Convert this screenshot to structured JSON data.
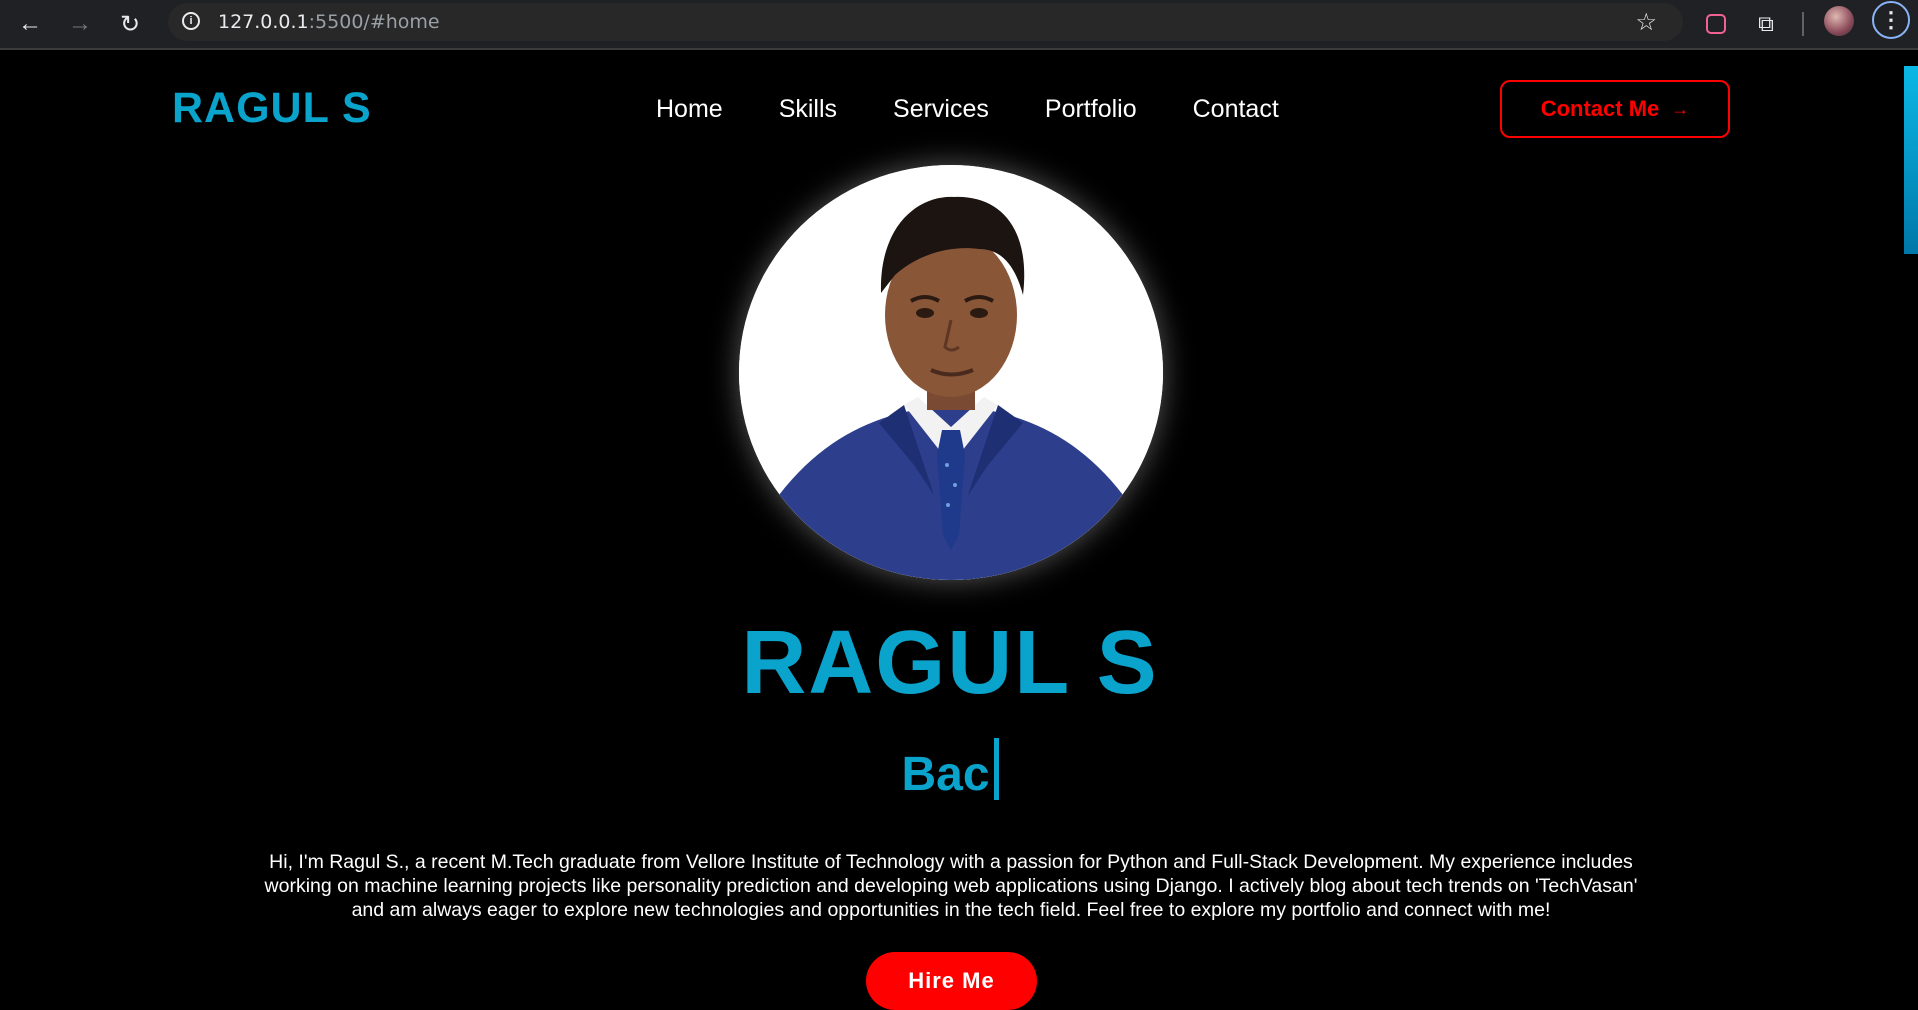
{
  "browser": {
    "url_host": "127.0.0.1",
    "url_rest": ":5500/#home",
    "icons": {
      "back": "arrow-left-icon",
      "forward": "arrow-right-icon",
      "reload": "reload-icon",
      "site_info": "info-icon",
      "bookmark": "star-icon",
      "extension": "lens-icon",
      "extensions": "puzzle-icon",
      "menu": "kebab-menu-icon"
    }
  },
  "header": {
    "logo": "RAGUL S",
    "nav": [
      "Home",
      "Skills",
      "Services",
      "Portfolio",
      "Contact"
    ],
    "contact_button": "Contact Me",
    "contact_arrow": "→"
  },
  "hero": {
    "name": "RAGUL S",
    "typed_text": "Bac",
    "bio": "Hi, I'm Ragul S., a recent M.Tech graduate from Vellore Institute of Technology with a passion for Python and Full-Stack Development. My experience includes working on machine learning projects like personality prediction and developing web applications using Django. I actively blog about tech trends on 'TechVasan' and am always eager to explore new technologies and opportunities in the tech field. Feel free to explore my portfolio and connect with me!",
    "hire_button": "Hire Me"
  },
  "colors": {
    "accent": "#0aa3cc",
    "button_red": "#ff0000",
    "background": "#000000"
  }
}
